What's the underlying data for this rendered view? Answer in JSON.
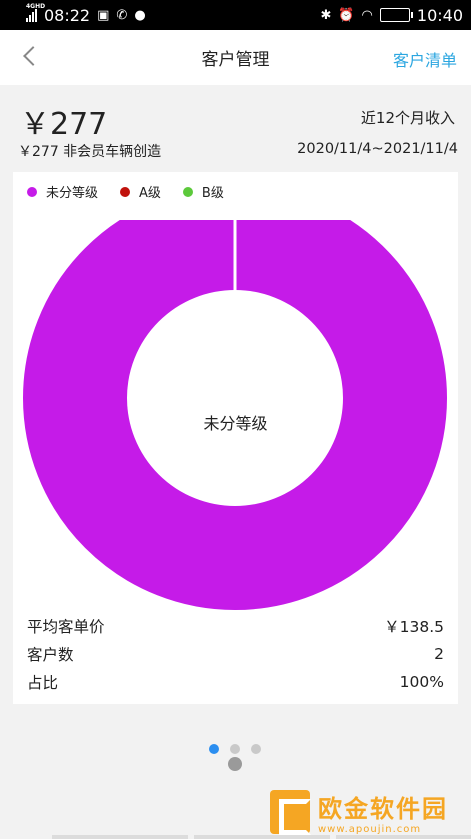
{
  "status_bar": {
    "network": "4GHD",
    "time": "08:22",
    "clock": "10:40"
  },
  "nav": {
    "title": "客户管理",
    "action": "客户清单"
  },
  "summary": {
    "amount": "￥277",
    "period_label": "近12个月收入",
    "sub_amount": "￥277 非会员车辆创造",
    "date_range": "2020/11/4~2021/11/4"
  },
  "legend": [
    {
      "label": "未分等级",
      "color": "#c51be8"
    },
    {
      "label": "A级",
      "color": "#c0120c"
    },
    {
      "label": "B级",
      "color": "#5cc93b"
    }
  ],
  "chart_data": {
    "type": "pie",
    "donut": true,
    "categories": [
      "未分等级",
      "A级",
      "B级"
    ],
    "values": [
      100,
      0,
      0
    ],
    "colors": [
      "#c51be8",
      "#c0120c",
      "#5cc93b"
    ],
    "center_label": "未分等级"
  },
  "stats": [
    {
      "label": "平均客单价",
      "value": "￥138.5"
    },
    {
      "label": "客户数",
      "value": "2"
    },
    {
      "label": "占比",
      "value": "100%"
    }
  ],
  "pager": {
    "count": 3,
    "active": 0
  },
  "watermark": {
    "name": "欧金软件园",
    "url": "www.apoujin.com"
  }
}
